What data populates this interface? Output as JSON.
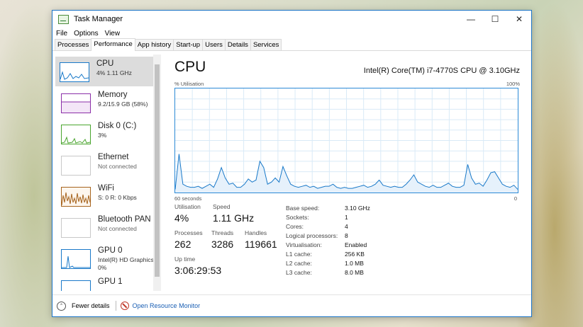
{
  "window": {
    "title": "Task Manager",
    "minimize": "—",
    "maximize": "☐",
    "close": "✕"
  },
  "menu": [
    "File",
    "Options",
    "View"
  ],
  "tabs": [
    "Processes",
    "Performance",
    "App history",
    "Start-up",
    "Users",
    "Details",
    "Services"
  ],
  "active_tab": "Performance",
  "sidebar": [
    {
      "title": "CPU",
      "sub": "4% 1.11 GHz",
      "color": "#1979c9",
      "selected": true
    },
    {
      "title": "Memory",
      "sub": "9.2/15.9 GB (58%)",
      "color": "#8b2fa8"
    },
    {
      "title": "Disk 0 (C:)",
      "sub": "3%",
      "color": "#4aa52e"
    },
    {
      "title": "Ethernet",
      "sub": "Not connected",
      "color": "#a7a7a7"
    },
    {
      "title": "WiFi",
      "sub": "S: 0 R: 0 Kbps",
      "color": "#a7641e"
    },
    {
      "title": "Bluetooth PAN",
      "sub": "Not connected",
      "color": "#a7a7a7"
    },
    {
      "title": "GPU 0",
      "sub": "Intel(R) HD Graphics\n0%",
      "color": "#1979c9"
    },
    {
      "title": "GPU 1",
      "sub": "",
      "color": "#1979c9"
    }
  ],
  "main": {
    "title": "CPU",
    "model": "Intel(R) Core(TM) i7-4770S CPU @ 3.10GHz",
    "util_label": "% Utilisation",
    "max_label": "100%",
    "time_label": "60 seconds",
    "zero_label": "0",
    "stats": {
      "utilisation_label": "Utilisation",
      "utilisation": "4%",
      "speed_label": "Speed",
      "speed": "1.11 GHz",
      "processes_label": "Processes",
      "processes": "262",
      "threads_label": "Threads",
      "threads": "3286",
      "handles_label": "Handles",
      "handles": "119661",
      "uptime_label": "Up time",
      "uptime": "3:06:29:53"
    },
    "specs": [
      {
        "label": "Base speed:",
        "value": "3.10 GHz"
      },
      {
        "label": "Sockets:",
        "value": "1"
      },
      {
        "label": "Cores:",
        "value": "4"
      },
      {
        "label": "Logical processors:",
        "value": "8"
      },
      {
        "label": "Virtualisation:",
        "value": "Enabled"
      },
      {
        "label": "L1 cache:",
        "value": "256 KB"
      },
      {
        "label": "L2 cache:",
        "value": "1.0 MB"
      },
      {
        "label": "L3 cache:",
        "value": "8.0 MB"
      }
    ],
    "cpu_history_percent": [
      3,
      37,
      8,
      6,
      5,
      5,
      6,
      4,
      6,
      8,
      5,
      13,
      24,
      14,
      8,
      9,
      5,
      5,
      8,
      13,
      10,
      12,
      30,
      24,
      8,
      10,
      14,
      10,
      25,
      16,
      8,
      6,
      5,
      6,
      7,
      5,
      6,
      4,
      5,
      6,
      6,
      8,
      5,
      4,
      5,
      4,
      4,
      5,
      6,
      7,
      5,
      6,
      8,
      12,
      7,
      6,
      5,
      6,
      5,
      5,
      8,
      12,
      17,
      10,
      8,
      6,
      5,
      7,
      5,
      5,
      7,
      9,
      6,
      5,
      5,
      7,
      27,
      14,
      8,
      9,
      6,
      12,
      19,
      20,
      14,
      8,
      6,
      5,
      7,
      3
    ]
  },
  "footer": {
    "fewer": "Fewer details",
    "resmon": "Open Resource Monitor"
  }
}
